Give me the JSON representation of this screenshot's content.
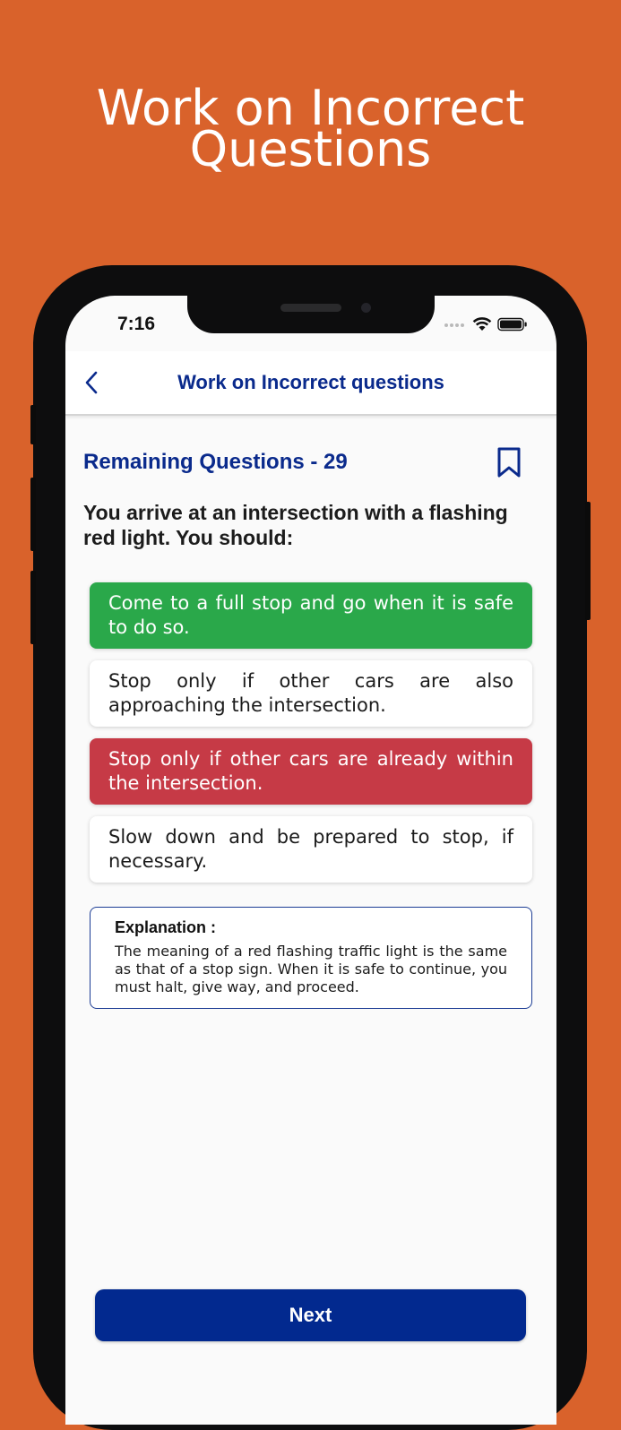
{
  "promo": {
    "title_line1": "Work on Incorrect",
    "title_line2": "Questions",
    "background": "#d9622b"
  },
  "status_bar": {
    "time": "7:16",
    "icons": [
      "signal-dots-icon",
      "wifi-icon",
      "battery-icon"
    ]
  },
  "navbar": {
    "back_icon": "chevron-left-icon",
    "title": "Work on Incorrect questions"
  },
  "quiz": {
    "remaining_label": "Remaining Questions - 29",
    "bookmark_icon": "bookmark-icon",
    "question": "You arrive at an intersection with a flashing red light. You should:",
    "options": [
      {
        "text": "Come to a full stop and go when it is safe to do so.",
        "state": "correct"
      },
      {
        "text": "Stop only if other cars are also approaching the intersection.",
        "state": "neutral"
      },
      {
        "text": "Stop only if other cars are already within the intersection.",
        "state": "wrong"
      },
      {
        "text": "Slow down and be prepared to stop, if necessary.",
        "state": "neutral"
      }
    ],
    "explanation_title": "Explanation :",
    "explanation_body": "The meaning of a red flashing traffic light is the same as that of a stop sign. When it is safe to continue, you must halt, give way, and proceed."
  },
  "footer": {
    "next_label": "Next"
  },
  "colors": {
    "accent": "#0a2a8c",
    "correct": "#2aa84a",
    "wrong": "#c63a46",
    "button": "#02298f"
  }
}
